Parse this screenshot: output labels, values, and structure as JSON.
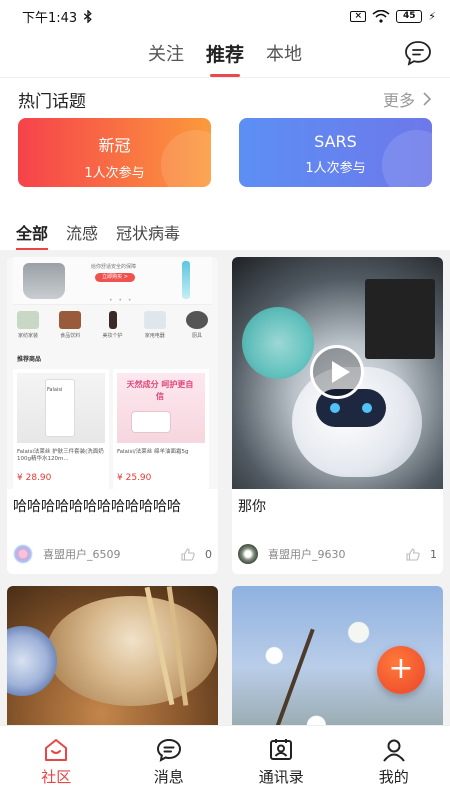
{
  "status_bar": {
    "time": "下午1:43",
    "bluetooth_icon": "bluetooth-icon",
    "sim_icon": "sim-off-icon",
    "wifi_icon": "wifi-icon",
    "battery_level": "45",
    "charging_icon": "bolt-icon"
  },
  "header": {
    "tabs": [
      {
        "label": "关注"
      },
      {
        "label": "推荐"
      },
      {
        "label": "本地"
      }
    ],
    "active_tab": 1,
    "message_icon": "chat-bubble-icon"
  },
  "hot_topics": {
    "title": "热门话题",
    "more_label": "更多",
    "cards": [
      {
        "name": "新冠",
        "participants": "1人次参与"
      },
      {
        "name": "SARS",
        "participants": "1人次参与"
      }
    ]
  },
  "categories": {
    "items": [
      {
        "label": "全部"
      },
      {
        "label": "流感"
      },
      {
        "label": "冠状病毒"
      }
    ],
    "active": 0
  },
  "feed": {
    "posts": [
      {
        "title": "哈哈哈哈哈哈哈哈哈哈哈哈",
        "user": "喜盟用户_6509",
        "likes": "0",
        "shop": {
          "banner_text": "给你舒适安全的保障",
          "buy_label": "立即购买 >",
          "icons": [
            "家纺家装",
            "食品饮料",
            "美妆个护",
            "家用电器",
            "厨具"
          ],
          "recommend_label": "推荐商品",
          "products": [
            {
              "name": "Falaisi法莱丝 护肤三件套装(洗面奶100g精华水120m...",
              "price": "¥ 28.90",
              "tag": "Falaisi"
            },
            {
              "name": "Falaisi/法莱丝 绵羊油面霜5g",
              "price": "¥ 25.90",
              "tag": "天然成分 呵护更自信"
            }
          ]
        }
      },
      {
        "title": "那你",
        "user": "喜盟用户_9630",
        "likes": "1",
        "is_video": true
      },
      {
        "title": "",
        "user": "",
        "likes": ""
      },
      {
        "title": "",
        "user": "",
        "likes": ""
      }
    ]
  },
  "fab": {
    "label": "+"
  },
  "bottom_nav": {
    "items": [
      {
        "label": "社区",
        "icon": "home-icon"
      },
      {
        "label": "消息",
        "icon": "message-icon"
      },
      {
        "label": "通讯录",
        "icon": "contacts-icon"
      },
      {
        "label": "我的",
        "icon": "profile-icon"
      }
    ],
    "active": 0
  },
  "colors": {
    "accent": "#e84545",
    "topic_red_start": "#f6424b",
    "topic_red_end": "#fb9a3c",
    "topic_blue_start": "#5c8ff4",
    "topic_blue_end": "#6d78ea"
  }
}
